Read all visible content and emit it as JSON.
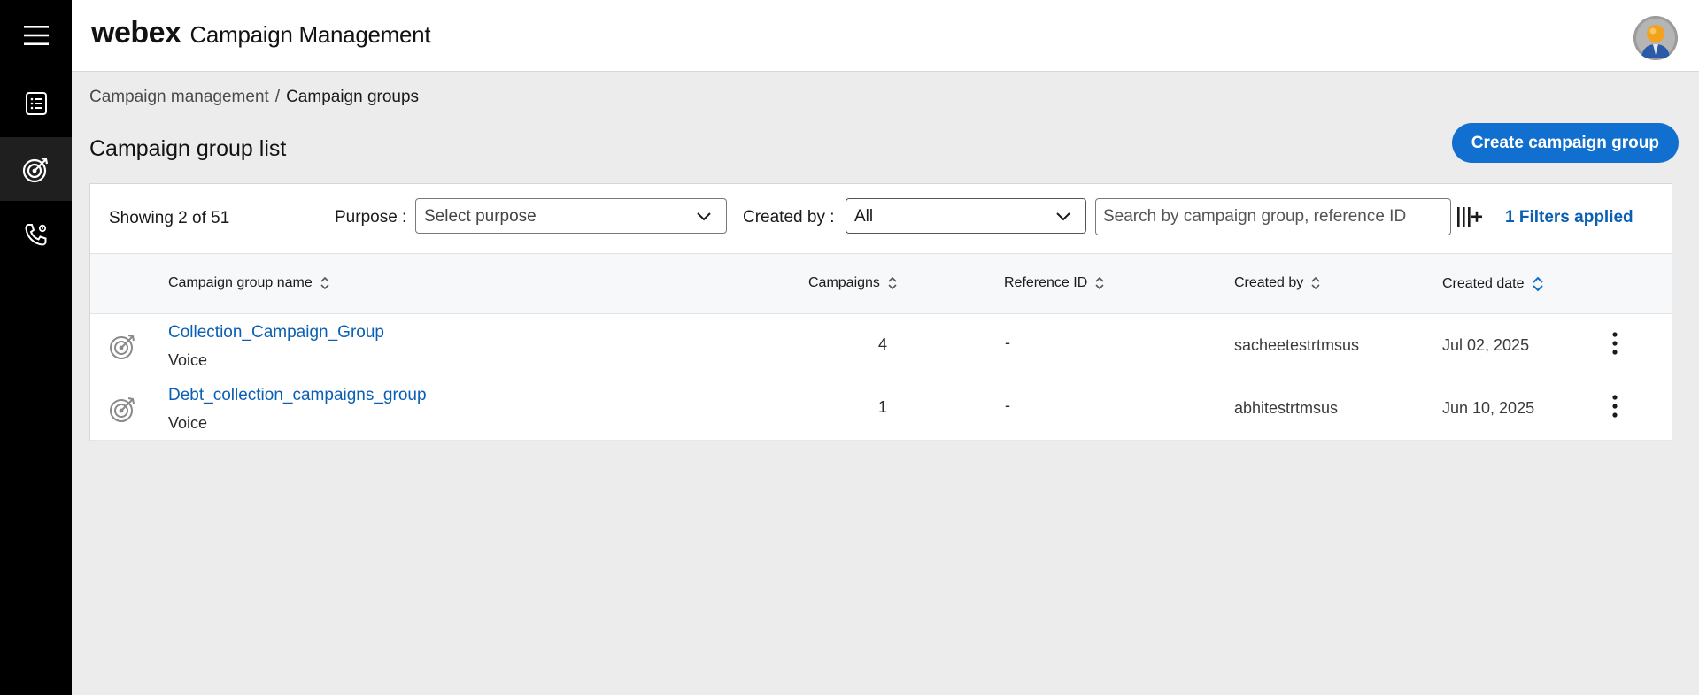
{
  "app": {
    "logo": "webex",
    "title": "Campaign Management"
  },
  "nav": {
    "items": [
      {
        "icon": "menu-icon"
      },
      {
        "icon": "list-document-icon"
      },
      {
        "icon": "target-icon",
        "active": true
      },
      {
        "icon": "phone-settings-icon"
      }
    ]
  },
  "breadcrumb": {
    "parent": "Campaign management",
    "separator": "/",
    "current": "Campaign groups"
  },
  "page": {
    "title": "Campaign group list",
    "create_button": "Create campaign group"
  },
  "toolbar": {
    "showing": "Showing 2 of 51",
    "purpose_label": "Purpose :",
    "purpose_value": "Select purpose",
    "created_by_label": "Created by :",
    "created_by_value": "All",
    "search_placeholder": "Search by campaign group, reference ID",
    "filters_applied": "1 Filters applied"
  },
  "table": {
    "headers": {
      "name": "Campaign group name",
      "campaigns": "Campaigns",
      "reference_id": "Reference ID",
      "created_by": "Created by",
      "created_date": "Created date"
    },
    "sorted_column": "created_date",
    "rows": [
      {
        "name": "Collection_Campaign_Group",
        "purpose": "Voice",
        "campaigns": "4",
        "reference_id": "-",
        "created_by": "sacheetestrtmsus",
        "created_date": "Jul 02, 2025"
      },
      {
        "name": "Debt_collection_campaigns_group",
        "purpose": "Voice",
        "campaigns": "1",
        "reference_id": "-",
        "created_by": "abhitestrtmsus",
        "created_date": "Jun 10, 2025"
      }
    ]
  },
  "colors": {
    "accent": "#1170cf",
    "link": "#0a5fb5",
    "rail": "#000000",
    "background": "#ececec"
  }
}
